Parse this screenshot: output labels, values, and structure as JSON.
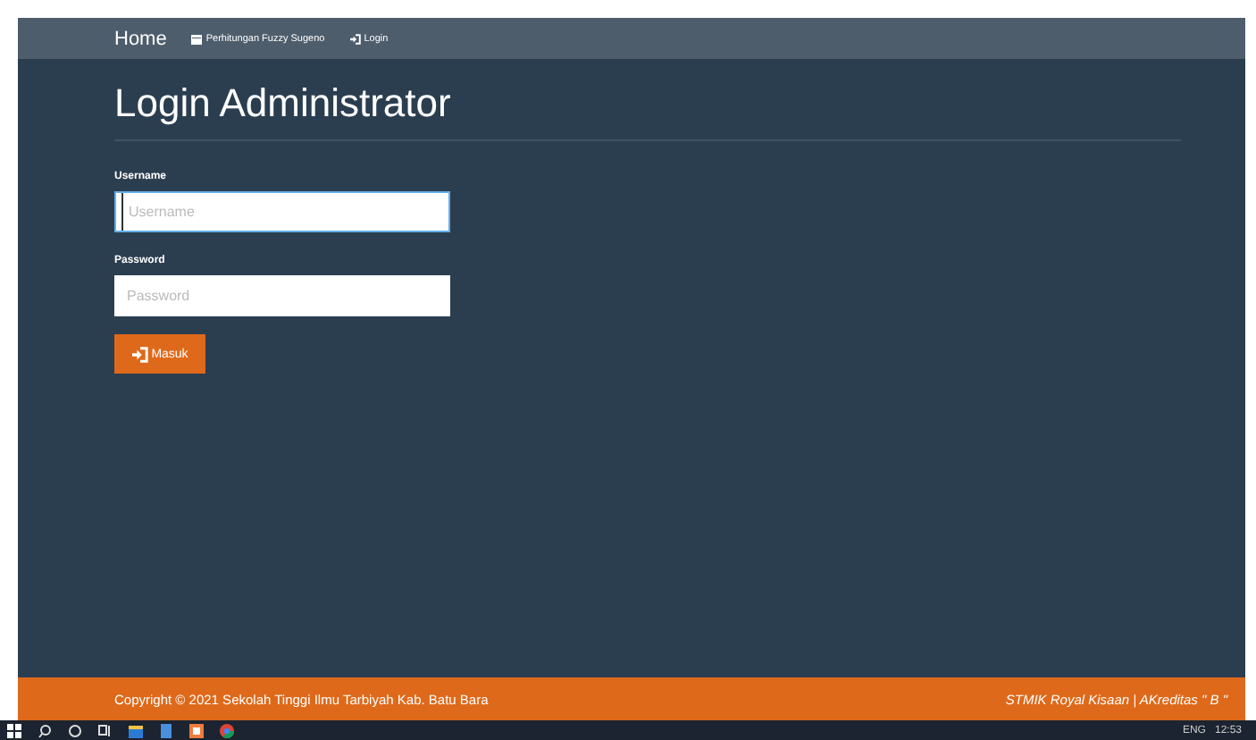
{
  "navbar": {
    "brand": "Home",
    "links": [
      {
        "label": "Perhitungan Fuzzy Sugeno",
        "kind": "calendar"
      },
      {
        "label": "Login",
        "kind": "login"
      }
    ]
  },
  "page_title": "Login Administrator",
  "form": {
    "fields": [
      {
        "label": "Username",
        "placeholder": "Username",
        "focused": true
      },
      {
        "label": "Password",
        "placeholder": "Password",
        "focused": false
      }
    ],
    "submit": "Masuk"
  },
  "footer": {
    "copyright": "Copyright © 2021 Sekolah Tinggi Ilmu Tarbiyah Kab. Batu Bara",
    "credit": "STMIK Royal Kisaan | AKreditas \" B \""
  },
  "taskbar": {
    "apps": [
      {
        "kind": "windows"
      },
      {
        "kind": "search"
      },
      {
        "kind": "cortana"
      },
      {
        "kind": "taskview"
      },
      {
        "kind": "explorer"
      },
      {
        "kind": "notes"
      },
      {
        "kind": "store"
      },
      {
        "kind": "chrome"
      }
    ],
    "language": "ENG",
    "time": "12:53"
  }
}
